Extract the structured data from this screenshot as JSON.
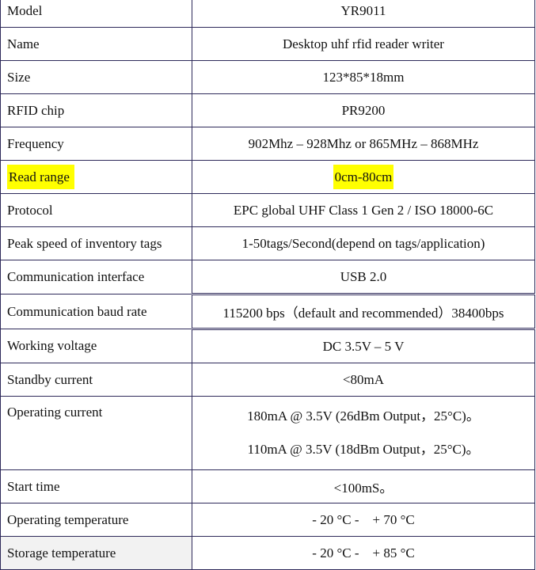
{
  "spec_table": {
    "rows": [
      {
        "label": "Model",
        "value": "YR9011"
      },
      {
        "label": "Name",
        "value": "Desktop uhf rfid reader writer"
      },
      {
        "label": "Size",
        "value": "123*85*18mm"
      },
      {
        "label": "RFID chip",
        "value": "PR9200"
      },
      {
        "label": "Frequency",
        "value": "902Mhz – 928Mhz or 865MHz – 868MHz"
      },
      {
        "label": "Read range",
        "value": "0cm-80cm",
        "highlight": "#ffff00"
      },
      {
        "label": "Protocol",
        "value": "EPC global UHF Class 1 Gen 2 / ISO 18000-6C"
      },
      {
        "label": "Peak speed of inventory tags",
        "value": "1-50tags/Second(depend on tags/application)"
      },
      {
        "label": "Communication interface",
        "value": "USB 2.0"
      },
      {
        "label": "Communication baud rate",
        "value": "115200 bps（default and recommended）38400bps"
      },
      {
        "label": "Working voltage",
        "value": "DC 3.5V – 5 V"
      },
      {
        "label": "Standby current",
        "value": "<80mA"
      },
      {
        "label": "Operating current",
        "values": [
          "180mA @ 3.5V (26dBm Output，25°C)。",
          "110mA @ 3.5V (18dBm Output，25°C)。"
        ]
      },
      {
        "label": "Start time",
        "value": "<100mS。"
      },
      {
        "label": "Operating temperature",
        "value": "- 20 °C -    + 70 °C"
      },
      {
        "label": "Storage temperature",
        "value": "- 20 °C -    + 85 °C"
      }
    ]
  }
}
